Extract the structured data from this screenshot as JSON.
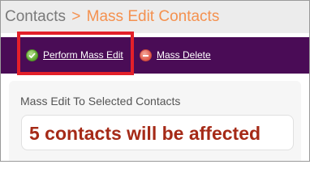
{
  "breadcrumb": {
    "root": "Contacts",
    "separator": ">",
    "current": "Mass Edit Contacts"
  },
  "toolbar": {
    "perform_mass_edit": "Perform Mass Edit",
    "mass_delete": "Mass Delete",
    "icons": {
      "perform_mass_edit": "check-circle-icon",
      "mass_delete": "minus-circle-icon"
    }
  },
  "section": {
    "title": "Mass Edit To Selected Contacts",
    "notice": "5 contacts will be affected"
  },
  "colors": {
    "toolbar_bg": "#4a0c56",
    "breadcrumb_accent": "#f4914f",
    "notice_text": "#a52a17",
    "highlight": "#e3202a"
  }
}
